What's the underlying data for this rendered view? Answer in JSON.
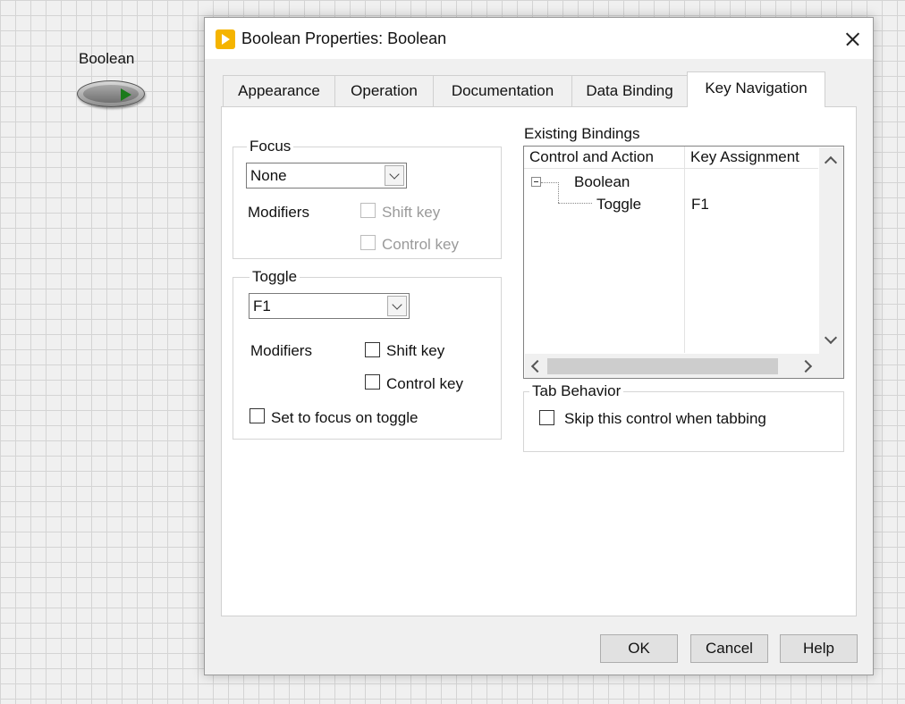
{
  "front_panel": {
    "control_label": "Boolean"
  },
  "dialog": {
    "title": "Boolean Properties: Boolean",
    "tabs": [
      {
        "label": "Appearance"
      },
      {
        "label": "Operation"
      },
      {
        "label": "Documentation"
      },
      {
        "label": "Data Binding"
      },
      {
        "label": "Key Navigation",
        "active": true
      }
    ],
    "focus": {
      "title": "Focus",
      "key_value": "None",
      "modifiers_label": "Modifiers",
      "shift_label": "Shift key",
      "control_label": "Control key"
    },
    "toggle": {
      "title": "Toggle",
      "key_value": "F1",
      "modifiers_label": "Modifiers",
      "shift_label": "Shift key",
      "control_label": "Control key",
      "set_focus_label": "Set to focus on toggle"
    },
    "bindings": {
      "title": "Existing Bindings",
      "columns": [
        "Control and Action",
        "Key Assignment"
      ],
      "rows": [
        {
          "control": "Boolean",
          "key": ""
        },
        {
          "control": "Toggle",
          "key": "F1"
        }
      ]
    },
    "tab_behavior": {
      "title": "Tab Behavior",
      "skip_label": "Skip this control when tabbing"
    },
    "buttons": {
      "ok": "OK",
      "cancel": "Cancel",
      "help": "Help"
    }
  }
}
